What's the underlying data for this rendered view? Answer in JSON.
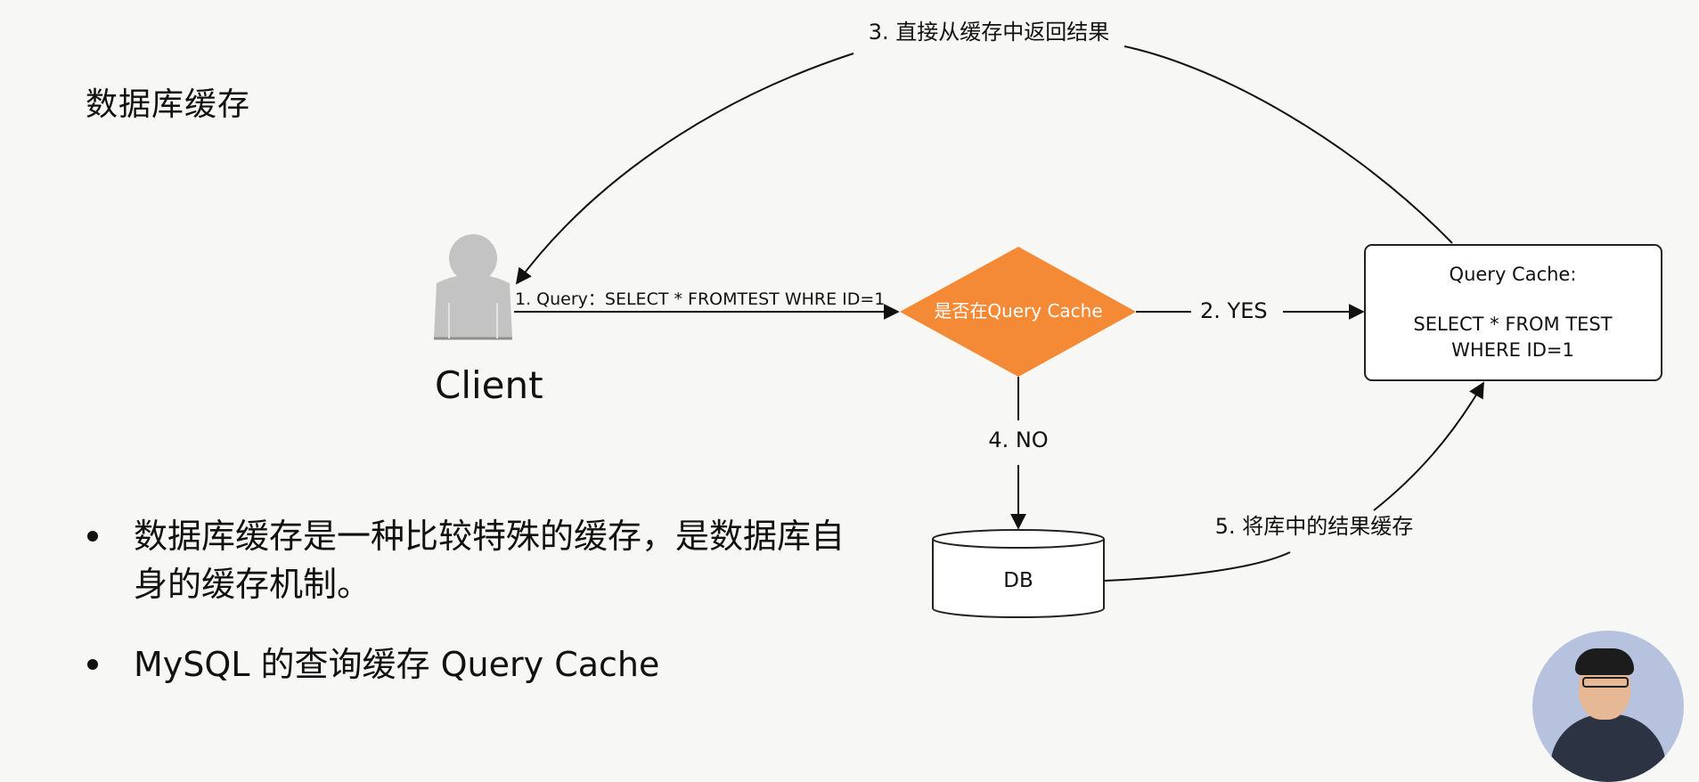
{
  "slide": {
    "title": "数据库缓存",
    "bullets": [
      "数据库缓存是一种比较特殊的缓存，是数据库自身的缓存机制。",
      "MySQL 的查询缓存 Query Cache"
    ]
  },
  "diagram": {
    "client_label": "Client",
    "step1": "1. Query：SELECT * FROMTEST WHRE ID=1",
    "decision": "是否在Query Cache",
    "step2": "2. YES",
    "step3": "3. 直接从缓存中返回结果",
    "step4": "4. NO",
    "step5": "5. 将库中的结果缓存",
    "cache_box": {
      "title": "Query Cache:",
      "line1": "SELECT * FROM TEST",
      "line2": "WHERE ID=1"
    },
    "db_label": "DB",
    "colors": {
      "decision_fill": "#f58a36",
      "person": "#c0c0c0"
    }
  },
  "presenter": {
    "icon": "presenter-webcam-avatar"
  }
}
